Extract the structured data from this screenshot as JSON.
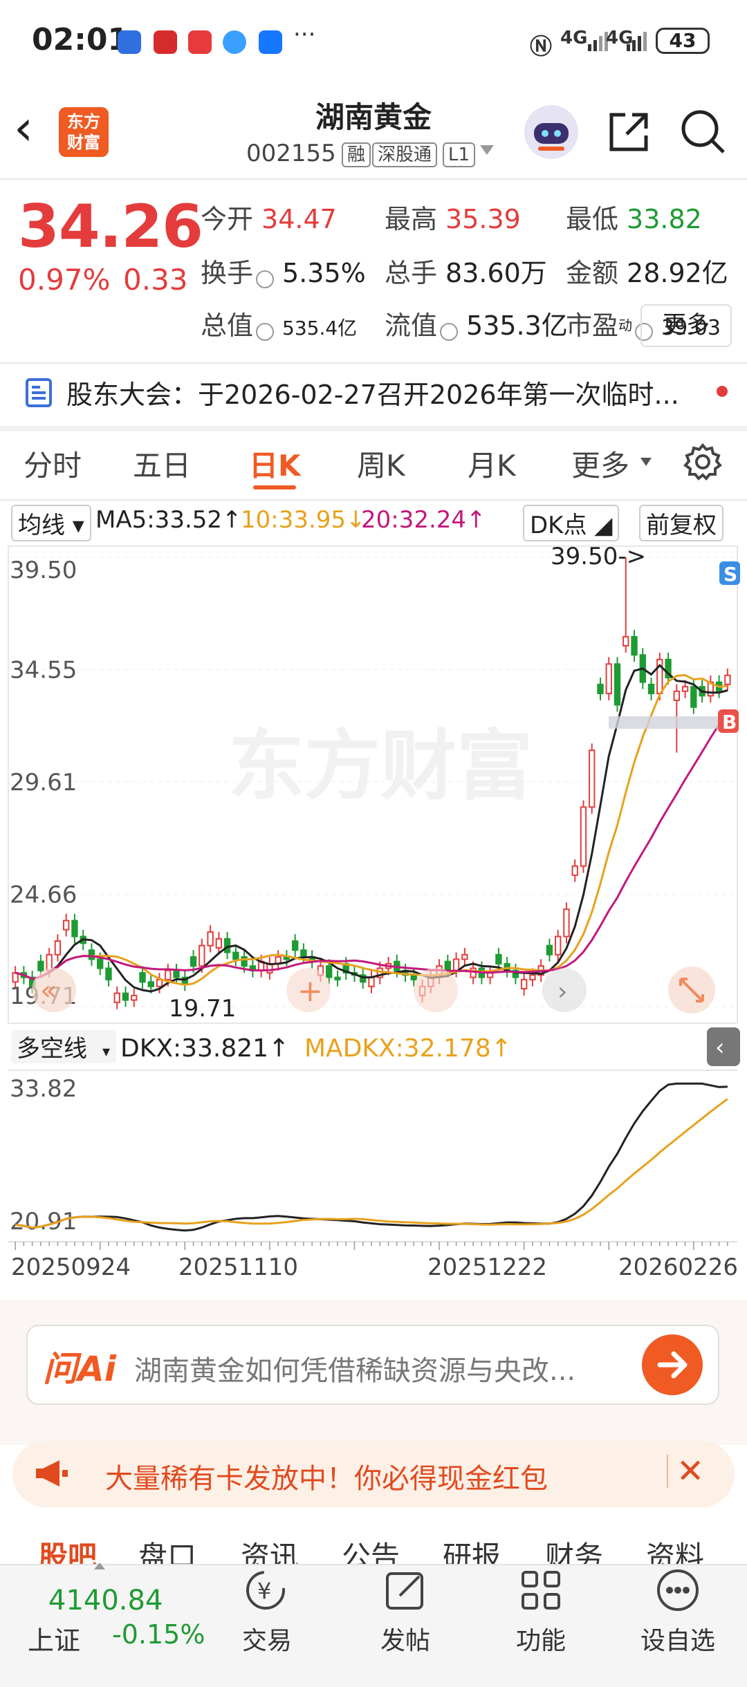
{
  "status_bar": {
    "time": "02:01",
    "dots": "···",
    "signal1": "4G",
    "signal2": "4G",
    "battery": "43"
  },
  "header": {
    "title": "湖南黄金",
    "code": "002155",
    "tags": [
      "融",
      "深股通",
      "L1"
    ],
    "logo_text_line1": "东方",
    "logo_text_line2": "财富"
  },
  "quote": {
    "price": "34.26",
    "change_pct": "0.97%",
    "change": "0.33",
    "stats": [
      {
        "label": "今开",
        "value": "34.47",
        "color": "red"
      },
      {
        "label": "最高",
        "value": "35.39",
        "color": "red"
      },
      {
        "label": "最低",
        "value": "33.82",
        "color": "green"
      },
      {
        "label": "换手",
        "value": "5.35%",
        "color": "dark"
      },
      {
        "label": "总手",
        "value": "83.60万",
        "color": "dark"
      },
      {
        "label": "金额",
        "value": "28.92亿",
        "color": "dark"
      },
      {
        "label": "总值",
        "value": "535.4亿",
        "color": "dark"
      },
      {
        "label": "流值",
        "value": "535.3亿",
        "color": "dark"
      },
      {
        "label": "市盈",
        "value": "39.03",
        "color": "dark",
        "sup": "动"
      }
    ],
    "more_button": "更多"
  },
  "announcement": {
    "text": "股东大会：于2026-02-27召开2026年第一次临时..."
  },
  "tabs": [
    {
      "label": "分时",
      "active": false
    },
    {
      "label": "五日",
      "active": false
    },
    {
      "label": "日K",
      "active": true
    },
    {
      "label": "周K",
      "active": false
    },
    {
      "label": "月K",
      "active": false
    },
    {
      "label": "更多",
      "active": false
    }
  ],
  "kline": {
    "indicator_select": "均线",
    "ma5": "MA5:33.52",
    "ma10": "10:33.95",
    "ma20": "20:32.24",
    "dk_button": "DK点",
    "adjust_button": "前复权",
    "y_labels": [
      "39.50",
      "34.55",
      "29.61",
      "24.66",
      "19.71"
    ],
    "high_marker": "39.50->",
    "low_marker": "19.71",
    "watermark": "东方财富",
    "buy_badge": "B",
    "sell_badge": "S",
    "colors": {
      "up": "#e43c3c",
      "down": "#1e9b33",
      "ma5": "#222222",
      "ma10": "#e8a11d",
      "ma20": "#c3187c"
    }
  },
  "dkx": {
    "indicator_select": "多空线",
    "dkx": "DKX:33.821",
    "madkx": "MADKX:32.178",
    "y_labels": [
      "33.82",
      "20.91"
    ]
  },
  "x_dates": [
    "20250924",
    "20251110",
    "20251222",
    "20260226"
  ],
  "ai": {
    "logo": "问Ai",
    "prompt": "湖南黄金如何凭借稀缺资源与央改..."
  },
  "promo": {
    "text": "大量稀有卡发放中！你必得现金红包"
  },
  "sub_tabs": [
    "股吧",
    "盘口",
    "资讯",
    "公告",
    "研报",
    "财务",
    "资料"
  ],
  "bottom_nav": {
    "index_value": "4140.84",
    "index_name": "上证",
    "index_change": "-0.15%",
    "items": [
      "交易",
      "发帖",
      "功能",
      "设自选"
    ]
  },
  "chart_data": {
    "type": "candlestick",
    "x_start": "20250924",
    "x_end": "20260226",
    "ylim": [
      19.71,
      39.5
    ],
    "series": [
      {
        "name": "MA5",
        "last": 33.52
      },
      {
        "name": "MA10",
        "last": 33.95
      },
      {
        "name": "MA20",
        "last": 32.24
      }
    ],
    "closes": [
      21.2,
      21.0,
      20.6,
      21.3,
      22.0,
      22.6,
      23.5,
      22.8,
      22.5,
      21.8,
      21.4,
      20.9,
      20.3,
      20.0,
      20.2,
      20.8,
      20.6,
      20.9,
      21.3,
      21.0,
      20.7,
      21.5,
      22.4,
      23.0,
      22.7,
      22.1,
      21.8,
      21.5,
      21.3,
      21.7,
      21.6,
      21.9,
      21.8,
      22.2,
      21.9,
      21.7,
      21.5,
      21.0,
      20.9,
      21.2,
      21.1,
      20.8,
      21.0,
      21.4,
      21.6,
      21.3,
      21.1,
      20.9,
      20.6,
      21.0,
      21.5,
      21.3,
      21.8,
      22.0,
      21.4,
      21.0,
      21.2,
      21.6,
      21.3,
      21.0,
      20.9,
      21.1,
      21.5,
      22.0,
      22.8,
      24.0,
      25.9,
      28.5,
      31.0,
      33.5,
      34.8,
      33.0,
      36.0,
      35.2,
      34.0,
      33.5,
      35.0,
      34.2,
      33.6,
      33.8,
      32.9,
      33.4,
      34.0,
      33.6,
      34.3
    ]
  }
}
